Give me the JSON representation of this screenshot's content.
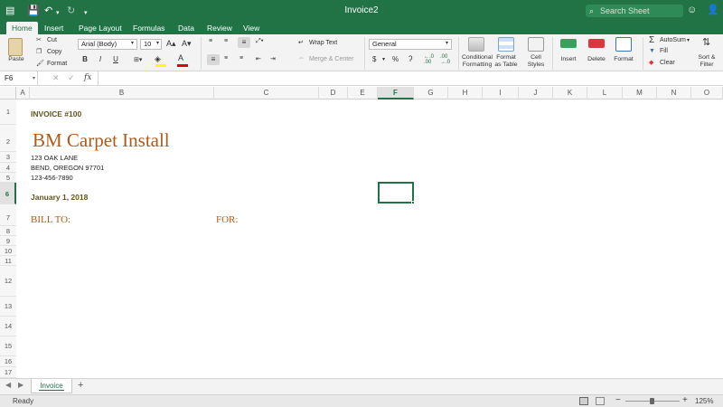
{
  "window": {
    "title": "Invoice2",
    "search_placeholder": "Search Sheet",
    "search_icon": "magnifier-icon",
    "smiley_icon": "feedback-smiley-icon",
    "share_icon": "add-person-icon"
  },
  "ribbon_tabs": [
    "Home",
    "Insert",
    "Page Layout",
    "Formulas",
    "Data",
    "Review",
    "View"
  ],
  "ribbon": {
    "paste": "Paste",
    "cut": "Cut",
    "copy": "Copy",
    "format_painter": "Format",
    "font_name": "Arial (Body)",
    "font_size": "10",
    "bold": "B",
    "italic": "I",
    "underline": "U",
    "wrap_text": "Wrap Text",
    "merge_center": "Merge & Center",
    "number_format": "General",
    "currency": "$",
    "percent": "%",
    "comma": "ʔ",
    "conditional_formatting": [
      "Conditional",
      "Formatting"
    ],
    "format_as_table": [
      "Format",
      "as Table"
    ],
    "cell_styles": [
      "Cell",
      "Styles"
    ],
    "insert": "Insert",
    "delete": "Delete",
    "format": "Format",
    "autosum": "AutoSum",
    "fill": "Fill",
    "clear": "Clear",
    "sort_filter": [
      "Sort &",
      "Filter"
    ]
  },
  "formula_bar": {
    "name_box": "F6",
    "fx": "fx",
    "value": ""
  },
  "columns": [
    "A",
    "B",
    "C",
    "D",
    "E",
    "F",
    "G",
    "H",
    "I",
    "J",
    "K",
    "L",
    "M",
    "N",
    "O"
  ],
  "selected_cell": "F6",
  "rows": [
    "1",
    "2",
    "3",
    "4",
    "5",
    "6",
    "7",
    "8",
    "9",
    "10",
    "11",
    "12",
    "13",
    "14",
    "15",
    "16",
    "17"
  ],
  "cells": {
    "b1": "INVOICE #100",
    "b2": "BM Carpet Install",
    "b3": "123 OAK LANE",
    "b4": "BEND, OREGON 97701",
    "b5": "123-456-7890",
    "b6": "January 1, 2018",
    "b7": "BILL TO:",
    "c7": "FOR:"
  },
  "colors": {
    "accent": "#217346",
    "heading_rust": "#b05a1a",
    "heading_olive": "#5e5620"
  },
  "sheet_tabs": [
    "Invoice"
  ],
  "add_sheet_label": "+",
  "status": {
    "ready": "Ready",
    "zoom": "125%",
    "zoom_minus": "−",
    "zoom_plus": "+"
  }
}
